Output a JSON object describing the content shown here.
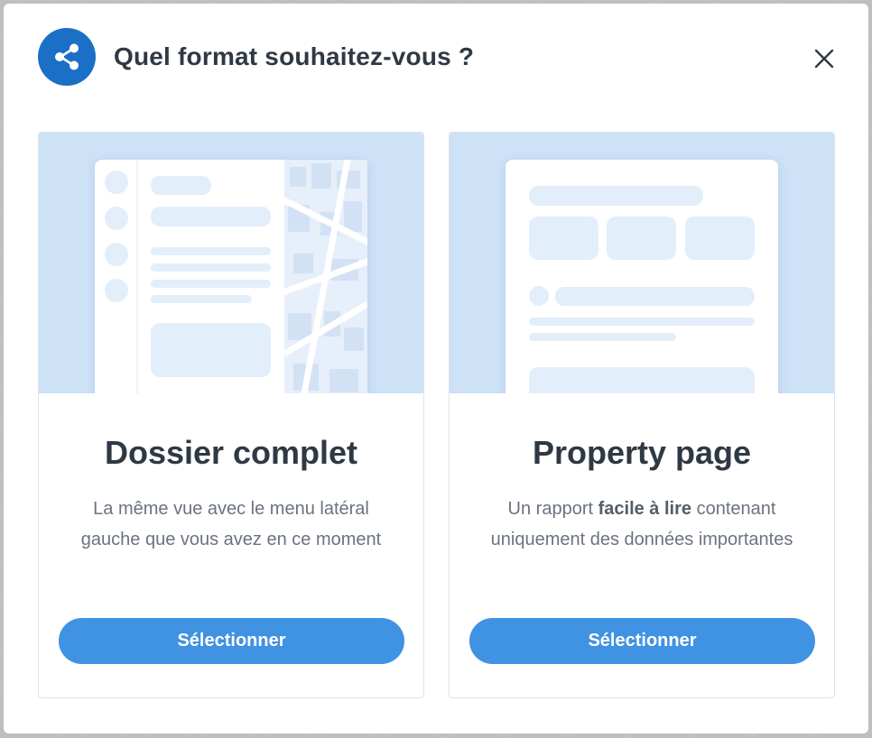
{
  "dialog": {
    "title": "Quel format souhaitez-vous ?",
    "header_icon": "share-icon",
    "close_icon": "close-icon"
  },
  "options": [
    {
      "title": "Dossier complet",
      "description": "La même vue avec le menu latéral gauche que vous avez en ce moment",
      "button_label": "Sélectionner"
    },
    {
      "title": "Property page",
      "description_parts": {
        "before": "Un rapport ",
        "bold": "facile à lire",
        "after": " contenant uniquement des données importantes"
      },
      "button_label": "Sélectionner"
    }
  ],
  "colors": {
    "accent": "#4092e2",
    "badge": "#1c6fc6",
    "preview_bg": "#cde1f7",
    "title_text": "#2f3944",
    "body_text": "#6b7380"
  }
}
